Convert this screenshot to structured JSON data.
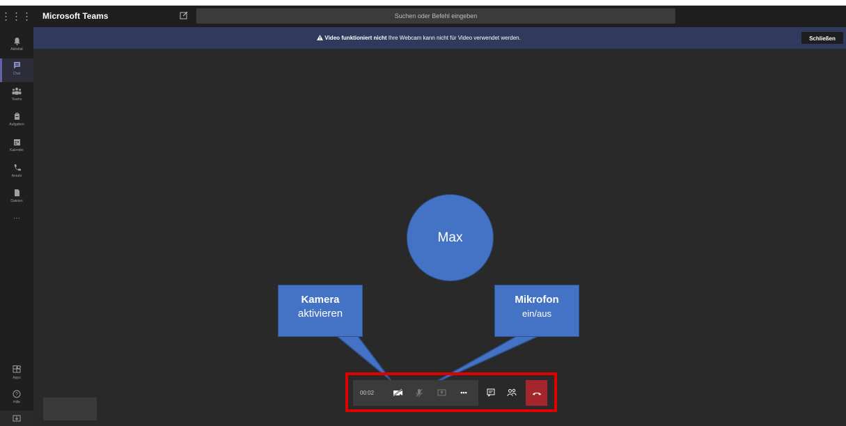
{
  "app": {
    "title": "Microsoft Teams"
  },
  "search": {
    "placeholder": "Suchen oder Befehl eingeben"
  },
  "icons": {
    "waffle": "waffle-icon",
    "compose": "compose-icon"
  },
  "rail": {
    "items": [
      {
        "label": "Aktivität",
        "icon": "bell-icon"
      },
      {
        "label": "Chat",
        "icon": "chat-icon"
      },
      {
        "label": "Teams",
        "icon": "teams-icon"
      },
      {
        "label": "Aufgaben",
        "icon": "tasks-icon"
      },
      {
        "label": "Kalender",
        "icon": "calendar-icon"
      },
      {
        "label": "Anrufe",
        "icon": "phone-icon"
      },
      {
        "label": "Dateien",
        "icon": "files-icon"
      }
    ],
    "more": "···",
    "bottom": [
      {
        "label": "Apps",
        "icon": "apps-icon"
      },
      {
        "label": "Hilfe",
        "icon": "help-icon"
      }
    ]
  },
  "banner": {
    "bold": "Video funktioniert nicht",
    "text": " Ihre Webcam kann nicht für Video verwendet werden.",
    "close": "Schließen"
  },
  "participant": {
    "name": "Max"
  },
  "callouts": {
    "camera": {
      "line1": "Kamera",
      "line2": "aktivieren"
    },
    "mic": {
      "line1": "Mikrofon",
      "line2": "ein/aus"
    }
  },
  "controls": {
    "timer": "00:02",
    "more": "•••"
  },
  "colors": {
    "accent": "#6264a7",
    "banner": "#2f3a5c",
    "hangup": "#a4262c",
    "callout": "#4472c4",
    "highlight": "#e00000"
  }
}
